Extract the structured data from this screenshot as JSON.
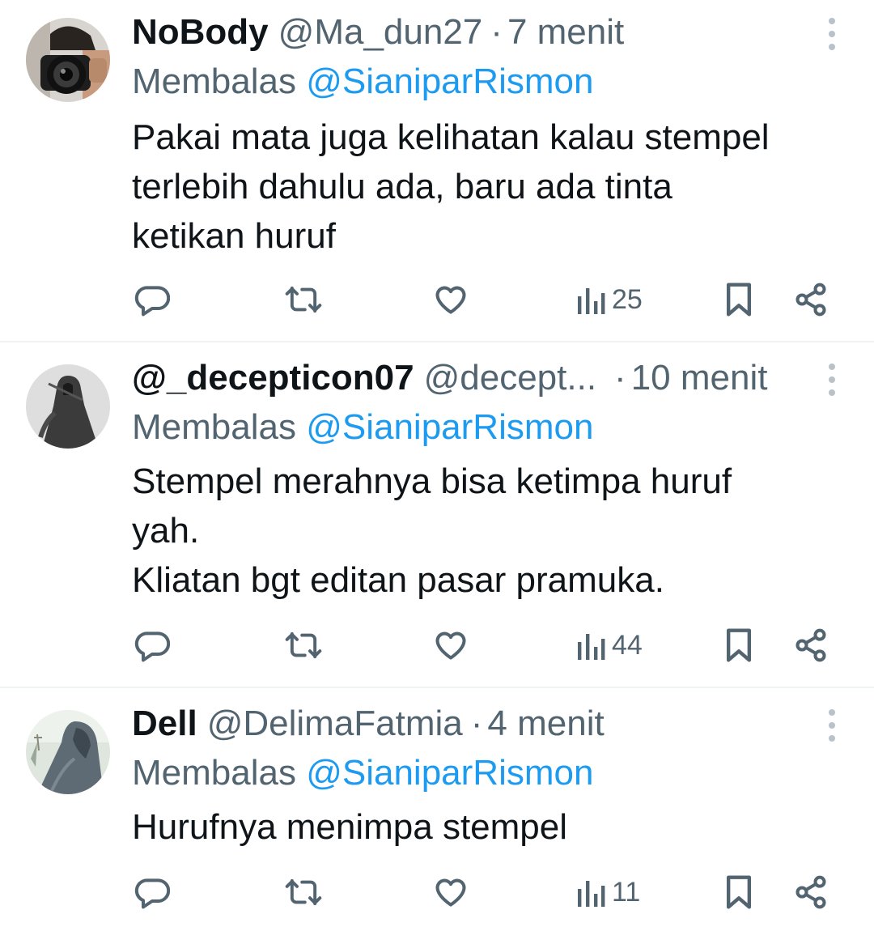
{
  "tweets": [
    {
      "name": "NoBody",
      "handle": "@Ma_dun27",
      "separator": "·",
      "time": "7 menit",
      "reply_prefix": "Membalas",
      "reply_to": "@SianiparRismon",
      "lines": [
        "Pakai mata juga kelihatan kalau stempel",
        "terlebih dahulu ada, baru ada tinta",
        "ketikan huruf"
      ],
      "views": "25",
      "avatar_icon": "photographer-avatar"
    },
    {
      "name": "@_decepticon07",
      "handle": "@decept...",
      "separator": "·",
      "time": "10 menit",
      "reply_prefix": "Membalas",
      "reply_to": "@SianiparRismon",
      "lines": [
        "Stempel merahnya bisa ketimpa huruf",
        "yah.",
        "Kliatan bgt editan pasar pramuka."
      ],
      "views": "44",
      "avatar_icon": "hooded-figure-avatar"
    },
    {
      "name": "Dell",
      "handle": "@DelimaFatmia",
      "separator": "·",
      "time": "4 menit",
      "reply_prefix": "Membalas",
      "reply_to": "@SianiparRismon",
      "lines": [
        "Hurufnya menimpa stempel"
      ],
      "views": "11",
      "avatar_icon": "veiled-figure-avatar"
    }
  ],
  "icons": [
    "reply-icon",
    "retweet-icon",
    "like-icon",
    "views-icon",
    "bookmark-icon",
    "share-icon",
    "more-options-icon"
  ],
  "colors": {
    "text": "#0f1419",
    "secondary": "#536471",
    "mention": "#1d9bf0",
    "divider": "#eff3f4"
  }
}
